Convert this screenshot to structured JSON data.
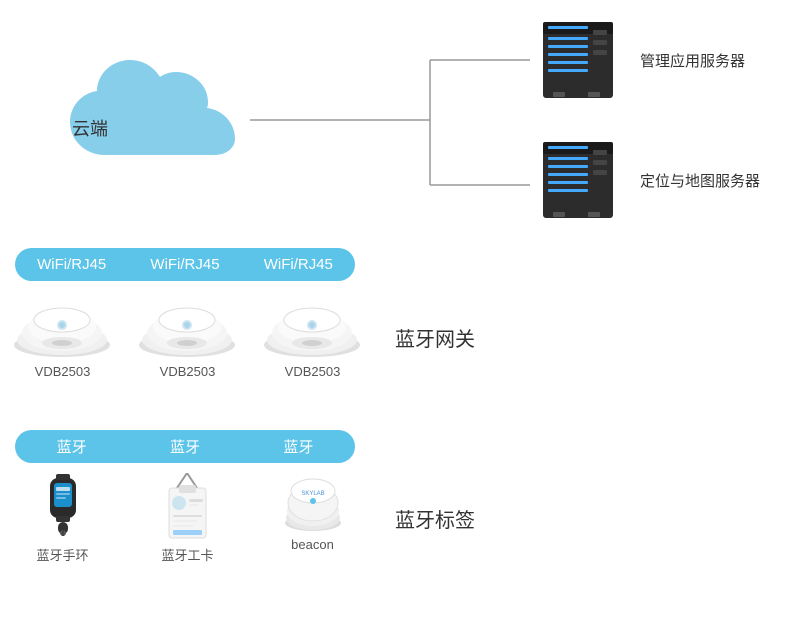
{
  "cloud": {
    "label": "云端"
  },
  "servers": [
    {
      "label": "管理应用服务器"
    },
    {
      "label": "定位与地图服务器"
    }
  ],
  "wifi_bar": {
    "items": [
      "WiFi/RJ45",
      "WiFi/RJ45",
      "WiFi/RJ45"
    ]
  },
  "gateway": {
    "title": "蓝牙网关",
    "devices": [
      {
        "label": "VDB2503"
      },
      {
        "label": "VDB2503"
      },
      {
        "label": "VDB2503"
      }
    ]
  },
  "bt_bar": {
    "items": [
      "蓝牙",
      "蓝牙",
      "蓝牙"
    ]
  },
  "tags": {
    "title": "蓝牙标签",
    "devices": [
      {
        "label": "蓝牙手环"
      },
      {
        "label": "蓝牙工卡"
      },
      {
        "label": "beacon"
      }
    ]
  }
}
